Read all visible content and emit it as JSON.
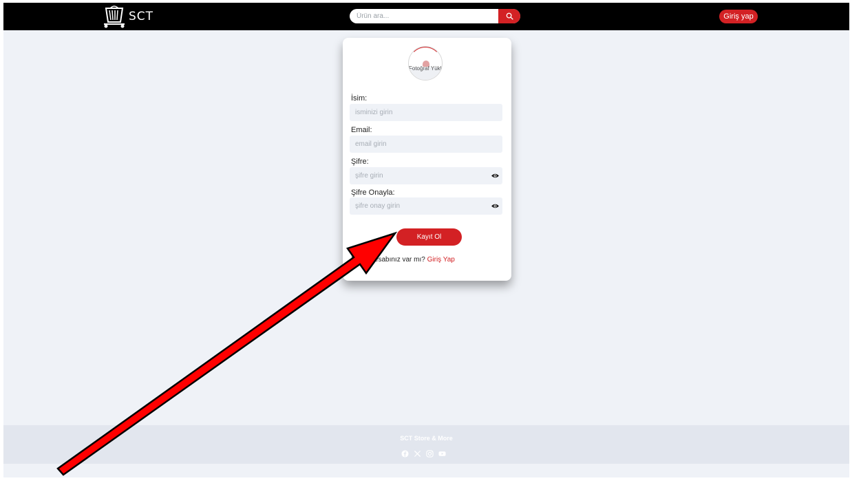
{
  "header": {
    "logo_text": "SCT",
    "search": {
      "placeholder": "Ürün ara..."
    },
    "login_label": "Giriş yap"
  },
  "form": {
    "photo_upload_label": "Fotoğraf Yükle",
    "name": {
      "label": "İsim:",
      "placeholder": "isminizi girin"
    },
    "email": {
      "label": "Email:",
      "placeholder": "email girin"
    },
    "password": {
      "label": "Şifre:",
      "placeholder": "şifre girin"
    },
    "password_confirm": {
      "label": "Şifre Onayla:",
      "placeholder": "şifre onay girin"
    },
    "submit_label": "Kayıt Ol",
    "already_text": "Zaten hesabınız var mı?",
    "login_link": "Giriş Yap"
  },
  "footer": {
    "title": "SCT Store & More",
    "socials": [
      "facebook-icon",
      "x-icon",
      "instagram-icon",
      "youtube-icon"
    ]
  },
  "colors": {
    "accent": "#d32124",
    "header_bg": "#000000",
    "page_bg": "#eff2f7",
    "footer_bg": "#e2e6ee"
  }
}
